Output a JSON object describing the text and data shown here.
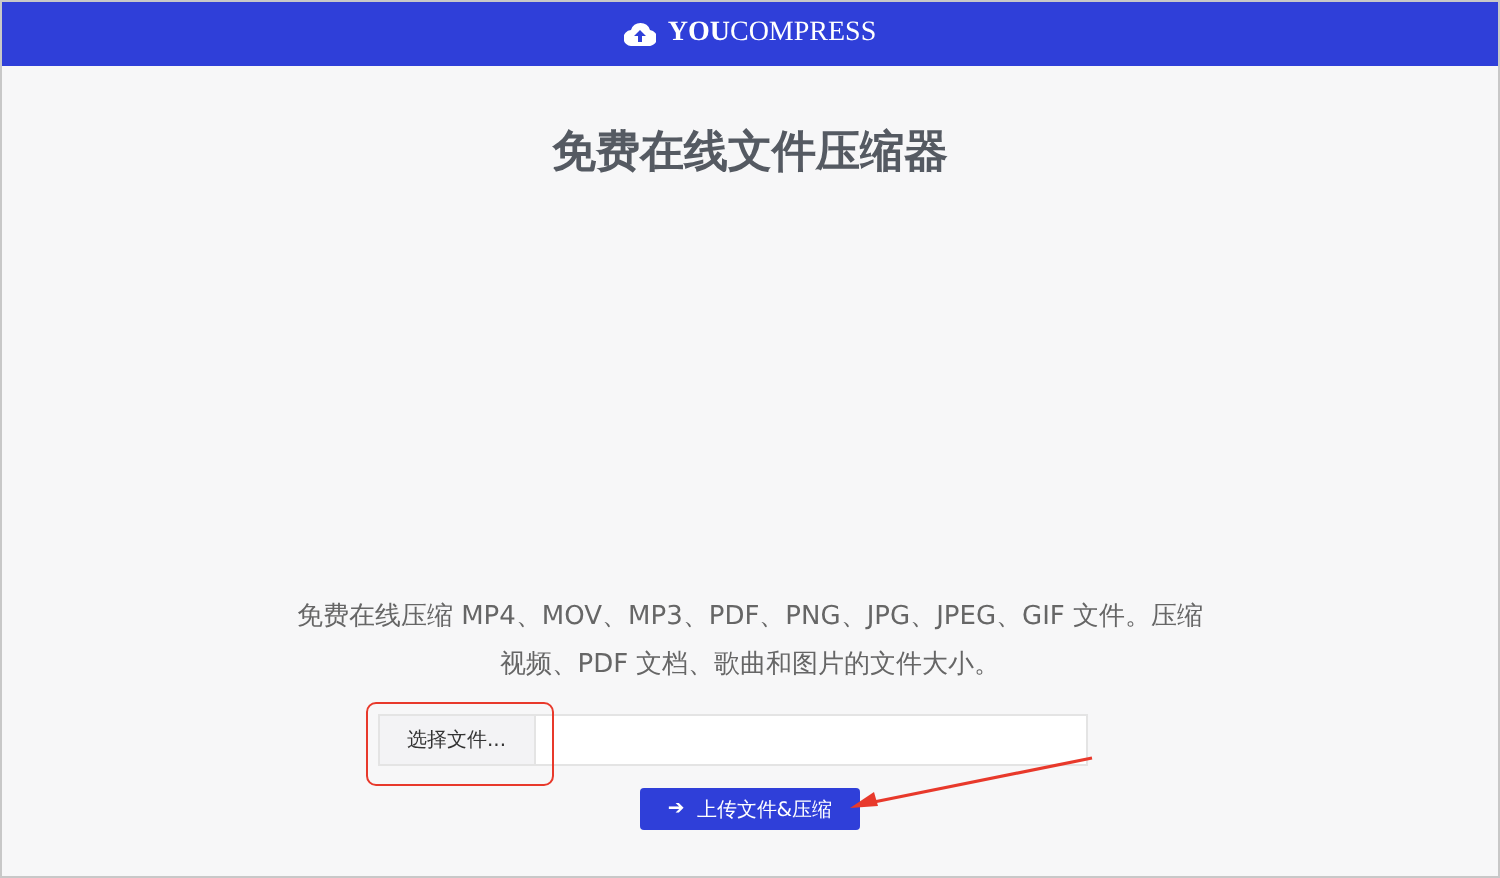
{
  "header": {
    "logo": "**YOU**COMPRESS"
  },
  "title": "免费在线文件压缩器",
  "description": "免费在线压缩 MP4、MOV、MP3、PDF、PNG、JPG、JPEG、GIF 文件。压缩视频、PDF 文档、歌曲和图片的文件大小。",
  "file_input": {
    "button": "选择文件..."
  },
  "submit": {
    "icon": "➔",
    "label": "上传文件&压缩"
  }
}
